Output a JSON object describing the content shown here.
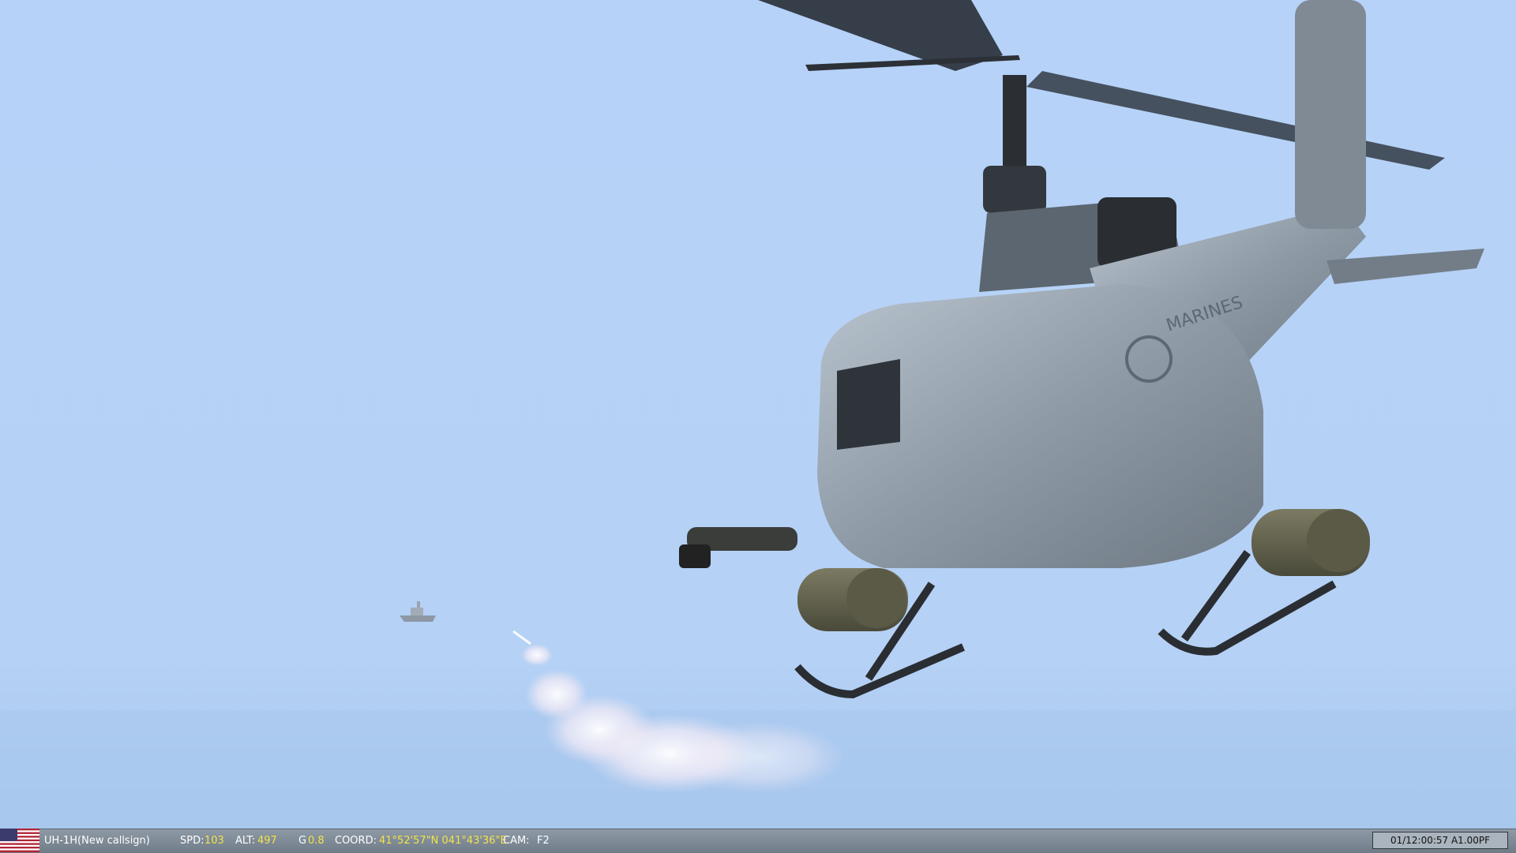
{
  "hud": {
    "unit_name": "UH-1H(New callsign)",
    "speed_label": "SPD:",
    "speed_value": "103",
    "alt_label": "ALT:",
    "alt_value": "497",
    "g_label": "G",
    "g_value": "0.8",
    "coord_label": "COORD:",
    "coord_value": "41°52'57\"N 041°43'36\"E",
    "cam_label": "CAM:",
    "cam_value": "F2",
    "time_readout": "01/12:00:57 A1.00PF",
    "flag_icon": "us-flag-icon"
  },
  "scene": {
    "description_icons": [
      "helicopter-icon",
      "ship-icon",
      "rocket-smoke-icon"
    ],
    "fuselage_text": "MARINES",
    "sky_color": "#b3cff6",
    "sea_color": "#a9c9ef"
  }
}
